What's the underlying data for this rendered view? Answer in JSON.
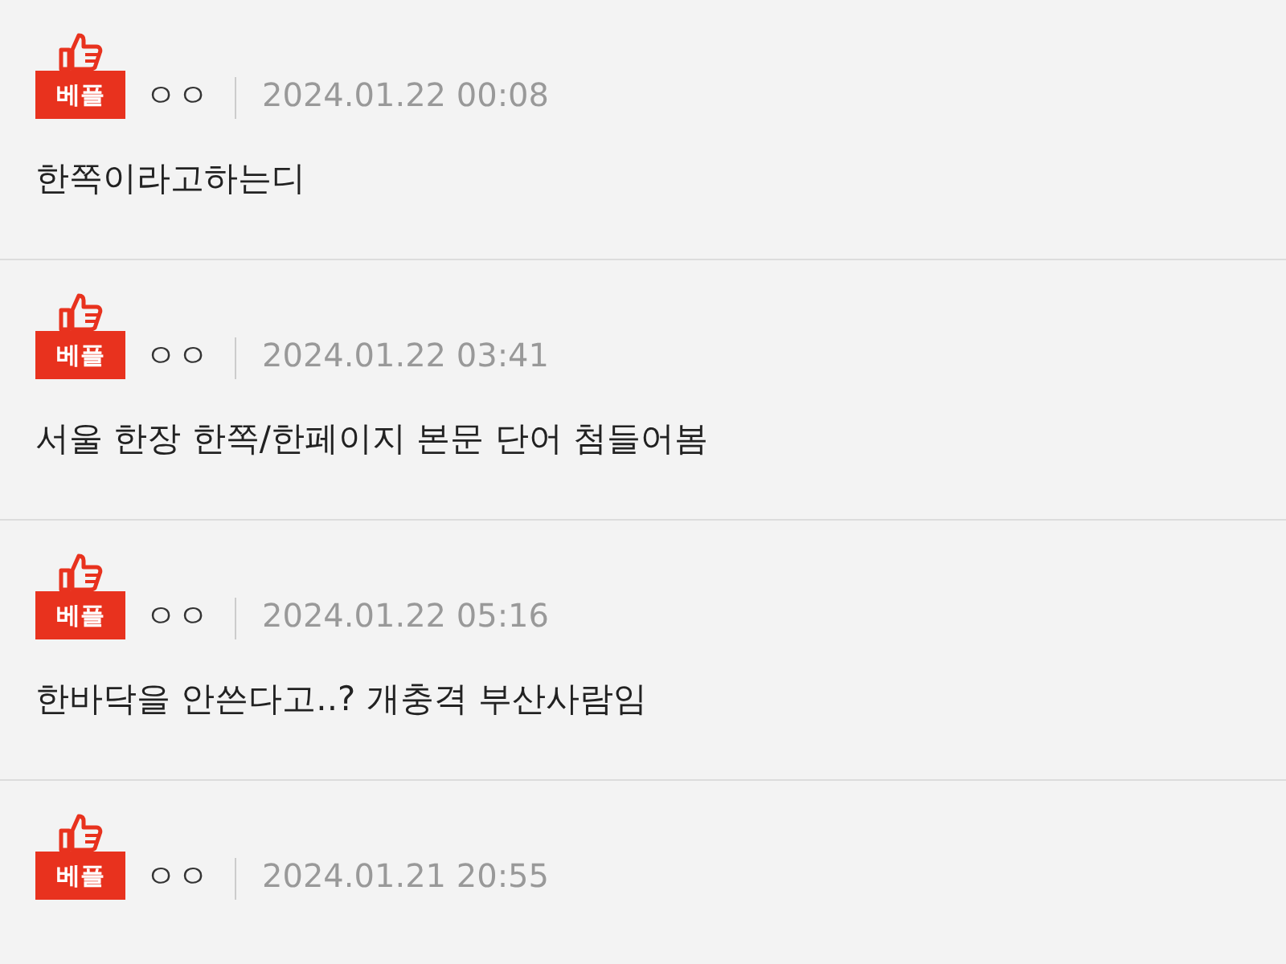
{
  "comments": [
    {
      "badge": "베플",
      "author": "ㅇㅇ",
      "date": "2024.01.22 00:08",
      "text": "한쪽이라고하는디"
    },
    {
      "badge": "베플",
      "author": "ㅇㅇ",
      "date": "2024.01.22 03:41",
      "text": "서울 한장 한쪽/한페이지 본문 단어 첨들어봄"
    },
    {
      "badge": "베플",
      "author": "ㅇㅇ",
      "date": "2024.01.22 05:16",
      "text": "한바닥을 안쓴다고..? 개충격 부산사람임"
    },
    {
      "badge": "베플",
      "author": "ㅇㅇ",
      "date": "2024.01.21 20:55"
    }
  ]
}
